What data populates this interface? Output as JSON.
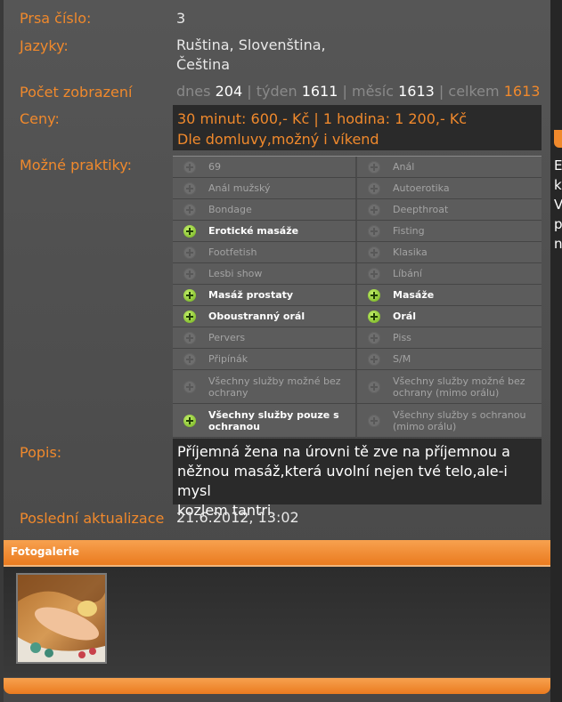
{
  "profile": {
    "bust_label": "Prsa číslo:",
    "bust_value": "3",
    "languages_label": "Jazyky:",
    "languages_line1": "Ruština, Slovenština,",
    "languages_line2": "Čeština",
    "views_label": "Počet zobrazení",
    "views": {
      "today_label": "dnes",
      "today": "204",
      "week_label": "týden",
      "week": "1611",
      "month_label": "měsíc",
      "month": "1613",
      "total_label": "celkem",
      "total": "1613",
      "separator": "|"
    },
    "prices_label": "Ceny:",
    "prices_line1": "30 minut: 600,- Kč | 1 hodina: 1 200,- Kč",
    "prices_line2": "Dle domluvy,možný i víkend",
    "practices_label": "Možné praktiky:",
    "practices": [
      {
        "name": "69",
        "available": false
      },
      {
        "name": "Anál",
        "available": false
      },
      {
        "name": "Anál mužský",
        "available": false
      },
      {
        "name": "Autoerotika",
        "available": false
      },
      {
        "name": "Bondage",
        "available": false
      },
      {
        "name": "Deepthroat",
        "available": false
      },
      {
        "name": "Erotické masáže",
        "available": true
      },
      {
        "name": "Fisting",
        "available": false
      },
      {
        "name": "Footfetish",
        "available": false
      },
      {
        "name": "Klasika",
        "available": false
      },
      {
        "name": "Lesbi show",
        "available": false
      },
      {
        "name": "Líbání",
        "available": false
      },
      {
        "name": "Masáž prostaty",
        "available": true
      },
      {
        "name": "Masáže",
        "available": true
      },
      {
        "name": "Oboustranný orál",
        "available": true
      },
      {
        "name": "Orál",
        "available": true
      },
      {
        "name": "Pervers",
        "available": false
      },
      {
        "name": "Piss",
        "available": false
      },
      {
        "name": "Připínák",
        "available": false
      },
      {
        "name": "S/M",
        "available": false
      },
      {
        "name": "Všechny služby možné bez ochrany",
        "available": false
      },
      {
        "name": "Všechny služby možné bez ochrany (mimo orálu)",
        "available": false
      },
      {
        "name": "Všechny služby pouze s ochranou",
        "available": true
      },
      {
        "name": "Všechny služby s ochranou (mimo orálu)",
        "available": false
      }
    ],
    "description_label": "Popis:",
    "description_line1": "Příjemná žena na úrovni tě zve na příjemnou a",
    "description_line2": "něžnou masáž,která uvolní nejen tvé telo,ale-i mysl",
    "description_line3": "kozlem tantri",
    "updated_label": "Poslední aktualizace",
    "updated_value": "21.6.2012, 13:02"
  },
  "gallery": {
    "title": "Fotogalerie"
  },
  "right_fragment": [
    "E",
    "k",
    "V",
    "p",
    "n"
  ],
  "colors": {
    "accent": "#f0892c",
    "panel": "#4f4f4f",
    "available_icon": "#8cc63f"
  },
  "icons": {
    "available": "plus-circle-icon",
    "unavailable": "plus-circle-disabled-icon"
  }
}
